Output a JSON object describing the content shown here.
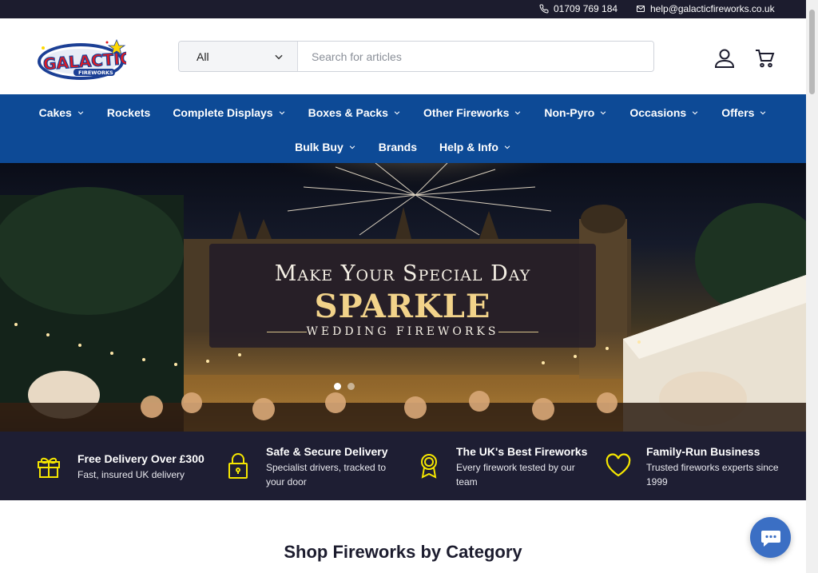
{
  "topbar": {
    "phone": "01709 769 184",
    "email": "help@galacticfireworks.co.uk",
    "phone_icon": "phone-icon",
    "email_icon": "mail-icon"
  },
  "header": {
    "logo_text": "GALACTIC",
    "logo_subtext": "FIREWORKS",
    "search": {
      "category": "All",
      "placeholder": "Search for articles"
    },
    "account_icon": "user-icon",
    "cart_icon": "cart-icon"
  },
  "nav": {
    "row1": [
      {
        "label": "Cakes",
        "dropdown": true
      },
      {
        "label": "Rockets",
        "dropdown": false
      },
      {
        "label": "Complete Displays",
        "dropdown": true
      },
      {
        "label": "Boxes & Packs",
        "dropdown": true
      },
      {
        "label": "Other Fireworks",
        "dropdown": true
      },
      {
        "label": "Non-Pyro",
        "dropdown": true
      },
      {
        "label": "Occasions",
        "dropdown": true
      },
      {
        "label": "Offers",
        "dropdown": true
      }
    ],
    "row2": [
      {
        "label": "Bulk Buy",
        "dropdown": true
      },
      {
        "label": "Brands",
        "dropdown": false
      },
      {
        "label": "Help & Info",
        "dropdown": true
      }
    ]
  },
  "hero": {
    "line1": "Make Your Special Day",
    "line2": "SPARKLE",
    "line3": "WEDDING FIREWORKS",
    "slide_count": 2,
    "active_slide": 1
  },
  "features": [
    {
      "icon": "gift-icon",
      "title": "Free Delivery Over £300",
      "subtitle": "Fast, insured UK delivery"
    },
    {
      "icon": "lock-icon",
      "title": "Safe & Secure Delivery",
      "subtitle": "Specialist drivers, tracked to your door"
    },
    {
      "icon": "award-icon",
      "title": "The UK's Best Fireworks",
      "subtitle": "Every firework tested by our team"
    },
    {
      "icon": "heart-icon",
      "title": "Family-Run Business",
      "subtitle": "Trusted fireworks experts since 1999"
    }
  ],
  "section": {
    "title": "Shop Fireworks by Category"
  },
  "chat_icon": "chat-icon",
  "colors": {
    "topbar": "#1c1c2e",
    "nav": "#0d4a96",
    "features_bg": "#1e1e33",
    "feature_icon": "#f5e600",
    "hero_gold": "#f2d38a",
    "chat": "#3b6fc4"
  }
}
